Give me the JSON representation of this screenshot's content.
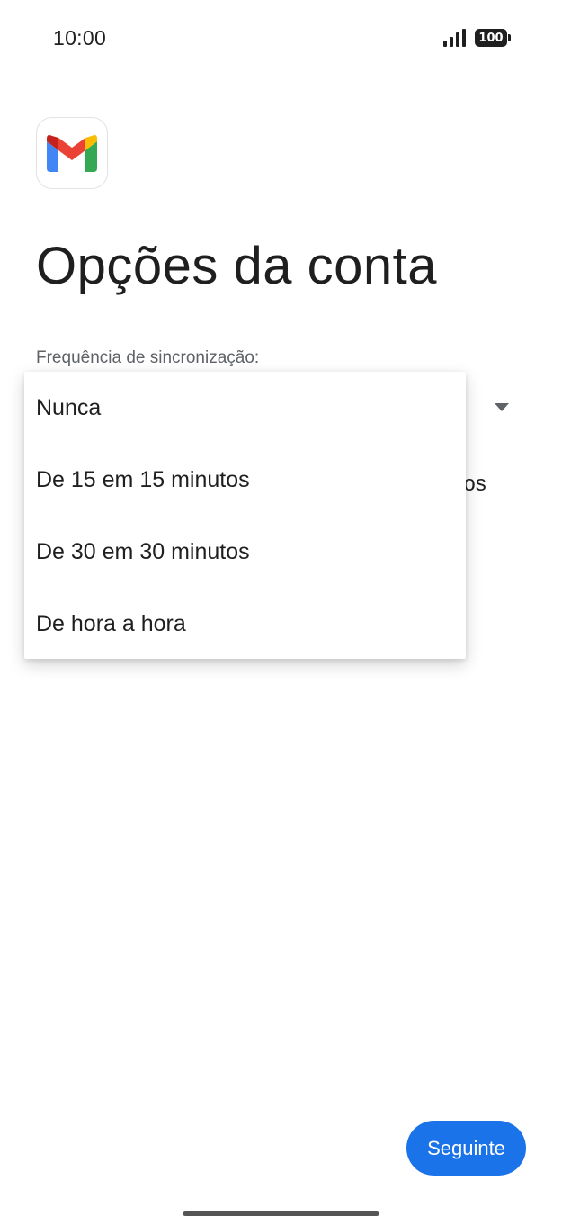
{
  "status_bar": {
    "time": "10:00",
    "battery": "100",
    "icons": [
      "signal-icon",
      "battery-icon"
    ]
  },
  "app": {
    "logo": "gmail-logo",
    "colors": {
      "red": "#ea4335",
      "blue": "#4285f4",
      "green": "#34a853",
      "yellow": "#fbbc04",
      "dark_red": "#c5221f"
    }
  },
  "page": {
    "title": "Opções da conta",
    "sync_label": "Frequência de sincronização:",
    "partial_hidden_text": "ovos"
  },
  "dropdown": {
    "options": [
      {
        "label": "Nunca"
      },
      {
        "label": "De 15 em 15 minutos"
      },
      {
        "label": "De 30 em 30 minutos"
      },
      {
        "label": "De hora a hora"
      }
    ]
  },
  "actions": {
    "next_label": "Seguinte",
    "accent": "#1a73e8"
  }
}
